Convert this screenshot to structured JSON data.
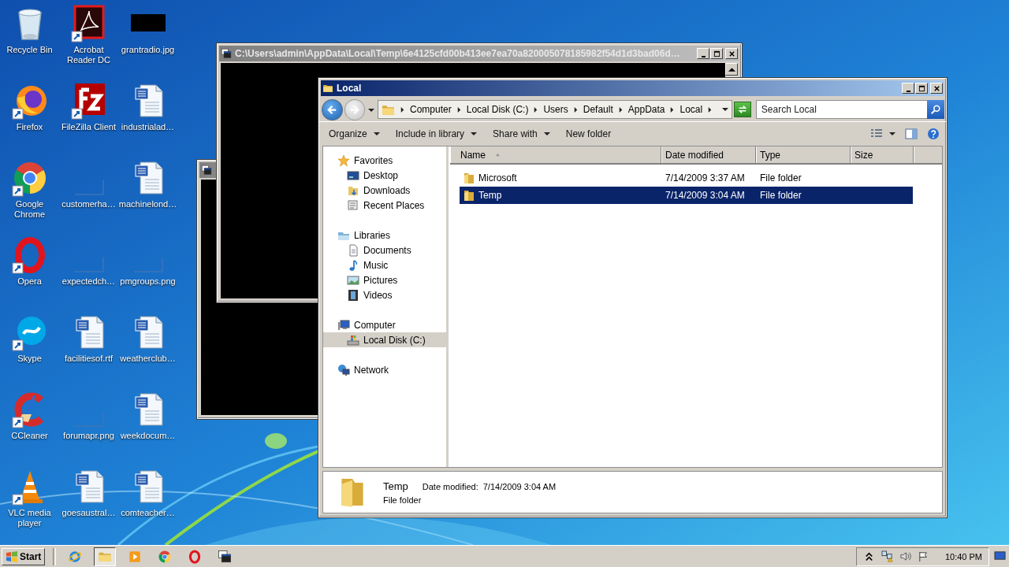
{
  "desktop": {
    "icons": [
      {
        "label": "Recycle Bin",
        "kind": "recycle-bin",
        "shortcut": false
      },
      {
        "label": "Acrobat Reader DC",
        "kind": "acrobat",
        "shortcut": true
      },
      {
        "label": "grantradio.jpg",
        "kind": "dark-image",
        "shortcut": false
      },
      {
        "label": "Firefox",
        "kind": "firefox",
        "shortcut": true
      },
      {
        "label": "FileZilla Client",
        "kind": "filezilla",
        "shortcut": true
      },
      {
        "label": "industrialad…",
        "kind": "word",
        "shortcut": false
      },
      {
        "label": "Google Chrome",
        "kind": "chrome",
        "shortcut": true
      },
      {
        "label": "customerha…",
        "kind": "blank-image",
        "shortcut": false
      },
      {
        "label": "machinelond…",
        "kind": "word",
        "shortcut": false
      },
      {
        "label": "Opera",
        "kind": "opera",
        "shortcut": true
      },
      {
        "label": "expectedch…",
        "kind": "blank-image",
        "shortcut": false
      },
      {
        "label": "pmgroups.png",
        "kind": "blank-image",
        "shortcut": false
      },
      {
        "label": "Skype",
        "kind": "skype",
        "shortcut": true
      },
      {
        "label": "facilitiesof.rtf",
        "kind": "word",
        "shortcut": false
      },
      {
        "label": "weatherclub…",
        "kind": "word",
        "shortcut": false
      },
      {
        "label": "CCleaner",
        "kind": "ccleaner",
        "shortcut": true
      },
      {
        "label": "forumapr.png",
        "kind": "blank-image",
        "shortcut": false
      },
      {
        "label": "weekdocum…",
        "kind": "word",
        "shortcut": false
      },
      {
        "label": "VLC media player",
        "kind": "vlc",
        "shortcut": true
      },
      {
        "label": "goesaustral…",
        "kind": "word",
        "shortcut": false
      },
      {
        "label": "comteacher…",
        "kind": "word",
        "shortcut": false
      }
    ]
  },
  "console_window": {
    "title": "C:\\Users\\admin\\AppData\\Local\\Temp\\6e4125cfd00b413ee7ea70a820005078185982f54d1d3bad06d…"
  },
  "explorer": {
    "title": "Local",
    "address": {
      "crumbs": [
        "Computer",
        "Local Disk (C:)",
        "Users",
        "Default",
        "AppData",
        "Local"
      ]
    },
    "search": {
      "placeholder": "Search Local"
    },
    "toolbar": [
      {
        "label": "Organize",
        "dropdown": true
      },
      {
        "label": "Include in library",
        "dropdown": true
      },
      {
        "label": "Share with",
        "dropdown": true
      },
      {
        "label": "New folder",
        "dropdown": false
      }
    ],
    "nav": [
      {
        "label": "Favorites",
        "kind": "star",
        "selected": false,
        "children": [
          {
            "label": "Desktop",
            "kind": "desktop",
            "selected": false
          },
          {
            "label": "Downloads",
            "kind": "downloads",
            "selected": false
          },
          {
            "label": "Recent Places",
            "kind": "recent",
            "selected": false
          }
        ]
      },
      {
        "label": "Libraries",
        "kind": "libraries",
        "selected": false,
        "children": [
          {
            "label": "Documents",
            "kind": "documents",
            "selected": false
          },
          {
            "label": "Music",
            "kind": "music",
            "selected": false
          },
          {
            "label": "Pictures",
            "kind": "pictures",
            "selected": false
          },
          {
            "label": "Videos",
            "kind": "videos",
            "selected": false
          }
        ]
      },
      {
        "label": "Computer",
        "kind": "computer",
        "selected": false,
        "children": [
          {
            "label": "Local Disk (C:)",
            "kind": "drive",
            "selected": true
          }
        ]
      },
      {
        "label": "Network",
        "kind": "network",
        "selected": false
      }
    ],
    "columns": [
      {
        "label": "Name",
        "sorted": true
      },
      {
        "label": "Date modified",
        "sorted": false
      },
      {
        "label": "Type",
        "sorted": false
      },
      {
        "label": "Size",
        "sorted": false
      }
    ],
    "rows": [
      {
        "name": "Microsoft",
        "date": "7/14/2009 3:37 AM",
        "type": "File folder",
        "selected": false
      },
      {
        "name": "Temp",
        "date": "7/14/2009 3:04 AM",
        "type": "File folder",
        "selected": true
      }
    ],
    "details": {
      "name": "Temp",
      "field_label": "Date modified:",
      "field_value": "7/14/2009 3:04 AM",
      "type": "File folder"
    }
  },
  "taskbar": {
    "start": "Start",
    "items": [
      {
        "kind": "ie",
        "active": false
      },
      {
        "kind": "folder",
        "active": true
      },
      {
        "kind": "media",
        "active": false
      },
      {
        "kind": "chrome",
        "active": false
      },
      {
        "kind": "opera",
        "active": false
      },
      {
        "kind": "console",
        "active": false
      }
    ],
    "clock": "10:40 PM"
  }
}
